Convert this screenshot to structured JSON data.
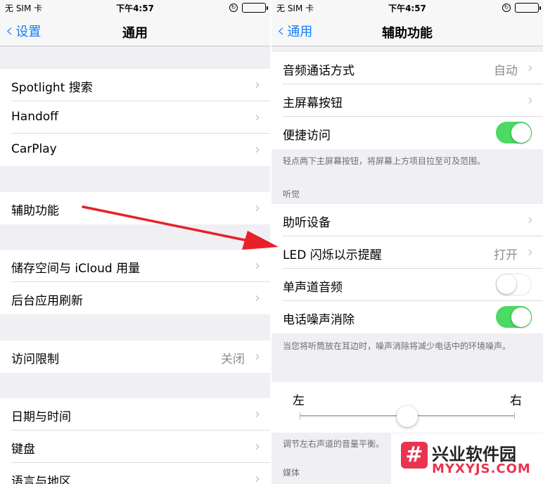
{
  "status": {
    "carrier": "无 SIM 卡",
    "time": "下午4:57"
  },
  "left": {
    "back_label": "设置",
    "title": "通用",
    "rows": [
      {
        "label": "Spotlight 搜索",
        "detail": ""
      },
      {
        "label": "Handoff",
        "detail": ""
      },
      {
        "label": "CarPlay",
        "detail": ""
      },
      {
        "label": "辅助功能",
        "detail": ""
      },
      {
        "label": "储存空间与 iCloud 用量",
        "detail": ""
      },
      {
        "label": "后台应用刷新",
        "detail": ""
      },
      {
        "label": "访问限制",
        "detail": "关闭"
      },
      {
        "label": "日期与时间",
        "detail": ""
      },
      {
        "label": "键盘",
        "detail": ""
      },
      {
        "label": "语言与地区",
        "detail": ""
      }
    ]
  },
  "right": {
    "back_label": "通用",
    "title": "辅助功能",
    "rows": [
      {
        "label": "音频通话方式",
        "detail": "自动",
        "type": "chevron"
      },
      {
        "label": "主屏幕按钮",
        "detail": "",
        "type": "chevron"
      },
      {
        "label": "便捷访问",
        "detail": "",
        "type": "toggle",
        "on": true
      },
      {
        "label": "助听设备",
        "detail": "",
        "type": "chevron"
      },
      {
        "label": "LED 闪烁以示提醒",
        "detail": "打开",
        "type": "chevron"
      },
      {
        "label": "单声道音频",
        "detail": "",
        "type": "toggle",
        "on": false
      },
      {
        "label": "电话噪声消除",
        "detail": "",
        "type": "toggle",
        "on": true
      }
    ],
    "note_reach": "轻点两下主屏幕按钮，将屏幕上方项目拉至可及范围。",
    "section_hearing": "听觉",
    "note_noise": "当您将听筒放在耳边时，噪声消除将减少电话中的环境噪声。",
    "balance": {
      "left": "左",
      "right": "右",
      "value": 0.5
    },
    "note_balance": "调节左右声道的音量平衡。",
    "section_media": "媒体"
  },
  "watermark": {
    "logo": "#",
    "name": "兴业软件园",
    "url": "MYXYJS.COM"
  },
  "colors": {
    "accent": "#157efb",
    "switch_on": "#4cd964",
    "arrow": "#e8202a"
  }
}
